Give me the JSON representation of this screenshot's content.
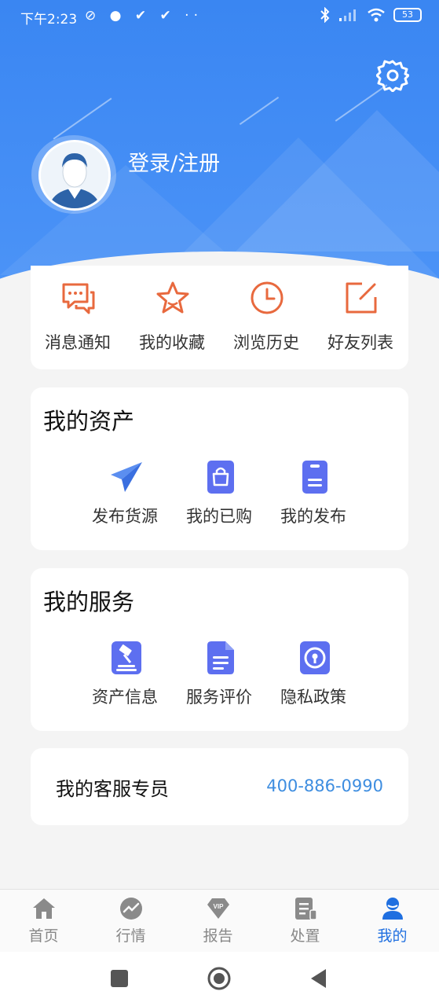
{
  "status_bar": {
    "time": "下午2:23",
    "left_icons": "⊘ ● ✔ ✔ ··",
    "battery": "53",
    "icons": [
      "bluetooth-icon",
      "signal-icon",
      "wifi-icon",
      "battery-icon"
    ]
  },
  "profile": {
    "login_label": "登录/注册",
    "settings_icon": "gear-icon",
    "avatar_icon": "user-avatar"
  },
  "quick_actions": [
    {
      "label": "消息通知",
      "icon": "message-icon",
      "color": "#e8693e"
    },
    {
      "label": "我的收藏",
      "icon": "star-icon",
      "color": "#e8693e"
    },
    {
      "label": "浏览历史",
      "icon": "clock-icon",
      "color": "#e8693e"
    },
    {
      "label": "好友列表",
      "icon": "share-icon",
      "color": "#e8693e"
    }
  ],
  "assets": {
    "title": "我的资产",
    "items": [
      {
        "label": "发布货源",
        "icon": "paper-plane-icon"
      },
      {
        "label": "我的已购",
        "icon": "shopping-bag-icon"
      },
      {
        "label": "我的发布",
        "icon": "clipboard-icon"
      }
    ]
  },
  "services": {
    "title": "我的服务",
    "items": [
      {
        "label": "资产信息",
        "icon": "gavel-icon"
      },
      {
        "label": "服务评价",
        "icon": "document-icon"
      },
      {
        "label": "隐私政策",
        "icon": "privacy-icon"
      }
    ]
  },
  "customer_service": {
    "label": "我的客服专员",
    "phone": "400-886-0990"
  },
  "tab_bar": [
    {
      "label": "首页",
      "icon": "home-icon",
      "active": false
    },
    {
      "label": "行情",
      "icon": "trend-icon",
      "active": false
    },
    {
      "label": "报告",
      "icon": "vip-diamond-icon",
      "active": false
    },
    {
      "label": "处置",
      "icon": "report-icon",
      "active": false
    },
    {
      "label": "我的",
      "icon": "user-icon",
      "active": true
    }
  ],
  "colors": {
    "header_blue": "#3a86f2",
    "accent_orange": "#e8693e",
    "tab_active": "#1f6fe0",
    "phone_blue": "#3d8de0"
  }
}
